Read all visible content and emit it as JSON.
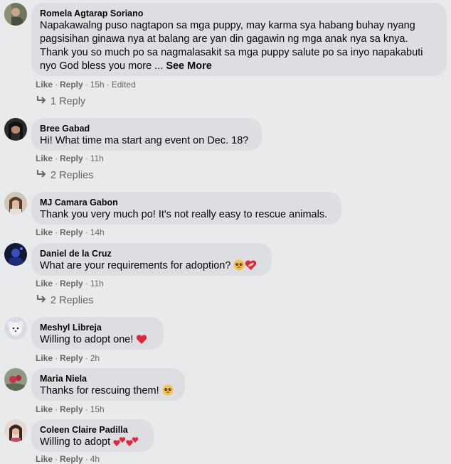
{
  "comments": [
    {
      "author": "Romela Agtarap Soriano",
      "line1": "Napakawalng puso nagtapon sa mga puppy, may karma sya habang buhay nyang",
      "line2": "pagsisihan ginawa nya at balang are yan din gagawin ng mga anak nya sa knya.",
      "line3": "Thank you so much po sa nagmalasakit sa mga puppy salute po sa inyo napakabuti",
      "line4": "nyo God bless you more ...",
      "see_more": "See More",
      "like": "Like",
      "reply": "Reply",
      "time": "15h",
      "edited": "Edited",
      "replies": "1 Reply"
    },
    {
      "author": "Bree Gabad",
      "text": "Hi! What time ma start ang event on Dec. 18?",
      "like": "Like",
      "reply": "Reply",
      "time": "11h",
      "replies": "2 Replies"
    },
    {
      "author": "MJ Camara Gabon",
      "text": "Thank you very much po! It's not really easy to rescue animals.",
      "like": "Like",
      "reply": "Reply",
      "time": "14h"
    },
    {
      "author": "Daniel de la Cruz",
      "text": "What are your requirements for adoption?",
      "like": "Like",
      "reply": "Reply",
      "time": "11h",
      "replies": "2 Replies"
    },
    {
      "author": "Meshyl Librejа",
      "text": "Willing to adopt one!",
      "like": "Like",
      "reply": "Reply",
      "time": "2h"
    },
    {
      "author": "Maria Niela",
      "text": "Thanks for rescuing them!",
      "like": "Like",
      "reply": "Reply",
      "time": "15h"
    },
    {
      "author": "Coleen Claire Padilla",
      "text": "Willing to adopt",
      "like": "Like",
      "reply": "Reply",
      "time": "4h"
    }
  ],
  "separator": "·",
  "icons": {
    "reply_arrow": "reply-arrow-icon",
    "heart": "red-heart-emoji",
    "pleading": "pleading-face-emoji",
    "heart_bandage": "mending-heart-emoji",
    "two_hearts": "two-hearts-emoji"
  },
  "colors": {
    "background": "#e9eaec",
    "bubble": "#dcdee2",
    "meta_text": "#65676b",
    "heart": "#e0263b",
    "emoji_face": "#f6c343"
  }
}
